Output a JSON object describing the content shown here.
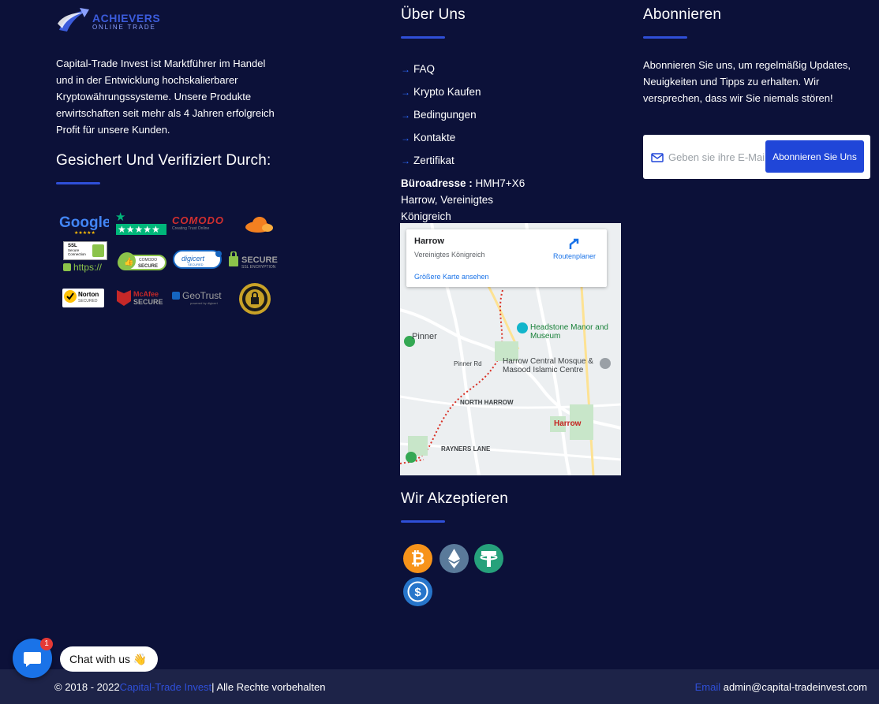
{
  "brand": {
    "name_line1": "ACHIEVERS",
    "name_line2": "ONLINE TRADE",
    "logo_icon": "swoosh-logo-icon"
  },
  "about": {
    "text": "Capital-Trade Invest ist Marktführer im Handel und in der Entwicklung hochskalierbarer Kryptowährungssysteme. Unsere Produkte erwirtschaften seit mehr als 4 Jahren erfolgreich Profit für unsere Kunden."
  },
  "secured": {
    "title": "Gesichert Und Verifiziert Durch:",
    "badges": {
      "google": "Google",
      "comodo": "COMODO",
      "comodo_sub": "Creating Trust Online",
      "ssl": "SSL",
      "ssl_sub": "Secure Connection",
      "https": "https://",
      "comodo_secure": "COMODO SECURE",
      "digicert": "digicert",
      "secure": "SECURE",
      "secure_sub": "SSL ENCRYPTION",
      "norton": "Norton",
      "norton_sub": "SECURED",
      "mcafee": "McAfee",
      "mcafee_sub": "SECURE",
      "geotrust": "GeoTrust"
    }
  },
  "about_us": {
    "title": "Über Uns",
    "links": [
      "FAQ",
      "Krypto Kaufen",
      "Bedingungen",
      "Kontakte",
      "Zertifikat"
    ],
    "address_label": "Büroadresse :",
    "address_value": " HMH7+X6 Harrow, Vereinigtes Königreich"
  },
  "map": {
    "place": "Harrow",
    "address": "Vereinigtes Königreich",
    "directions": "Routenplaner",
    "larger_map": "Größere Karte ansehen",
    "labels": {
      "pinner": "Pinner",
      "headstone": "Headstone Manor and Museum",
      "mosque": "Harrow Central Mosque & Masood Islamic Centre",
      "north_harrow": "NORTH HARROW",
      "harrow": "Harrow",
      "rayners": "RAYNERS LANE",
      "pinner_rd": "Pinner Rd"
    }
  },
  "accept": {
    "title": "Wir Akzeptieren",
    "coins": [
      "bitcoin-icon",
      "ethereum-icon",
      "tether-icon",
      "usdc-icon"
    ]
  },
  "subscribe": {
    "title": "Abonnieren",
    "text": "Abonnieren Sie uns, um regelmäßig Updates, Neuigkeiten und Tipps zu erhalten. Wir versprechen, dass wir Sie niemals stören!",
    "placeholder": "Geben sie ihre E-Mail",
    "button": "Abonnieren Sie Uns"
  },
  "footer": {
    "copy_prefix": "© 2018 - 2022",
    "copy_brand": "Capital-Trade Invest",
    "copy_suffix": "| Alle Rechte vorbehalten",
    "email_label": "Email",
    "email_value": " admin@capital-tradeinvest.com"
  },
  "chat": {
    "label": "Chat with us 👋",
    "badge_count": "1"
  },
  "colors": {
    "background": "#0c1139",
    "accent": "#2f4fd8",
    "footer_bg": "#1d2348"
  }
}
